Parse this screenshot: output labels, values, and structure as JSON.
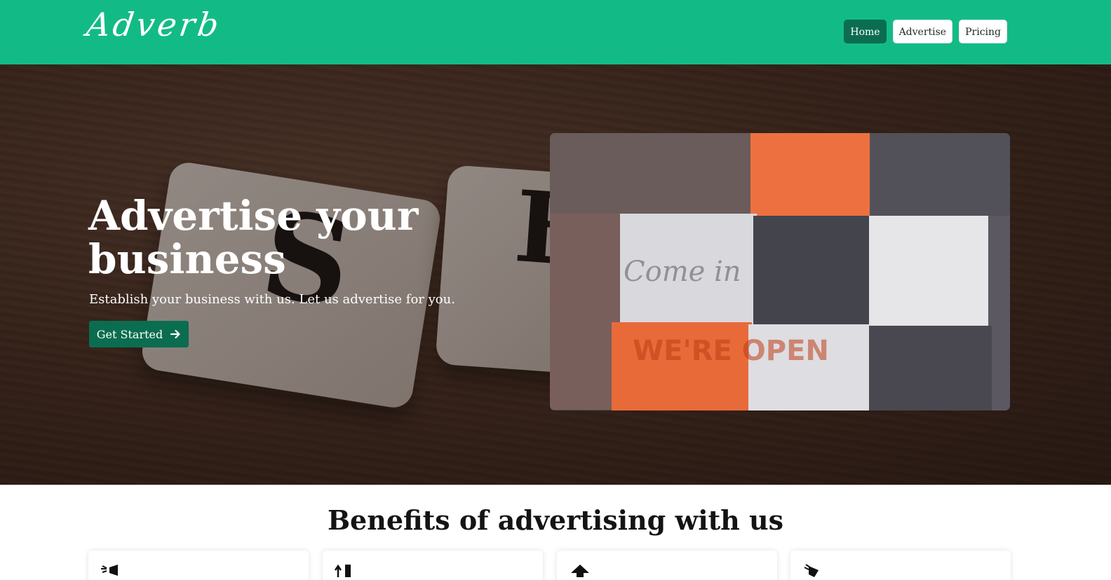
{
  "header": {
    "brand": "Adverb",
    "nav": [
      {
        "label": "Home",
        "active": true
      },
      {
        "label": "Advertise",
        "active": false
      },
      {
        "label": "Pricing",
        "active": false
      }
    ]
  },
  "hero": {
    "title": "Advertise your business",
    "subtitle": "Establish your business with us. Let us advertise for you.",
    "cta_label": "Get Started",
    "tile_letters": [
      "S",
      "E"
    ],
    "image_text": [
      "Come in",
      "WE'RE OPEN"
    ]
  },
  "benefits": {
    "title": "Benefits of advertising with us",
    "cards": [
      {
        "icon": "megaphone-icon"
      },
      {
        "icon": "growth-chart-icon"
      },
      {
        "icon": "arrow-up-icon"
      },
      {
        "icon": "rocket-icon"
      }
    ]
  },
  "colors": {
    "header": "#12bb85",
    "accent": "#0b6d4f"
  }
}
